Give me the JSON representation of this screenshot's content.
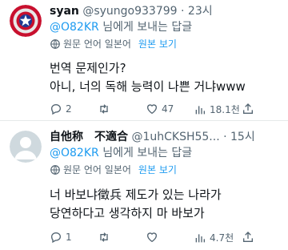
{
  "tweets": [
    {
      "display_name": "syan",
      "handle": "@syungo933799",
      "separator": "·",
      "time": "23시",
      "more": "···",
      "replying_prefix": "",
      "replying_mention": "@O82KR",
      "replying_suffix": " 님에게 보내는 답글",
      "translate_label": "원문 언어 일본어",
      "translate_link": "원본 보기",
      "lines": [
        "번역 문제인가?",
        "아니, 너의 독해 능력이 나쁜 거냐www"
      ],
      "stats": {
        "replies": "2",
        "retweets": "",
        "likes": "47",
        "views": "18.1천"
      }
    },
    {
      "display_name": "自他称　不適合",
      "handle": "@1uhCKSH55...",
      "separator": "·",
      "time": "15시",
      "more": "···",
      "replying_mention": "@O82KR",
      "replying_suffix": " 님에게 보내는 답글",
      "translate_label": "원문 언어 일본어",
      "translate_link": "원본 보기",
      "lines": [
        "너 바보냐徵兵 제도가 있는 나라가",
        "당연하다고 생각하지 마 바보가"
      ],
      "stats": {
        "replies": "1",
        "retweets": "",
        "likes": "",
        "views": "4.7천"
      }
    }
  ],
  "colors": {
    "link": "#1d9bf0",
    "muted": "#536471",
    "text": "#0f1419"
  }
}
